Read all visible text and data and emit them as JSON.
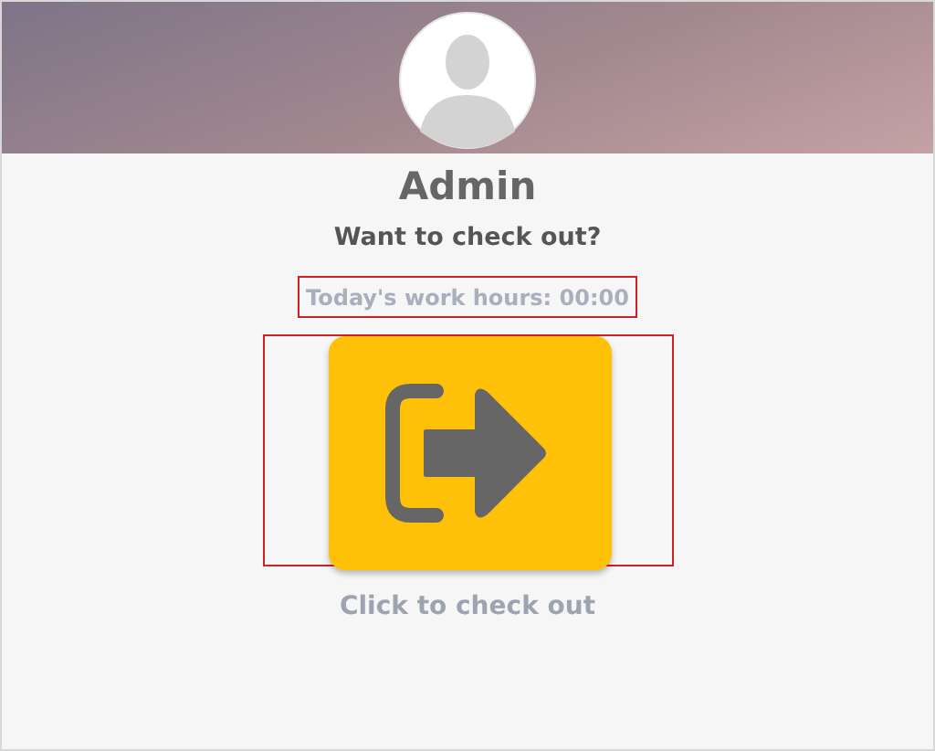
{
  "user": {
    "name": "Admin"
  },
  "prompt": "Want to check out?",
  "work_hours": "Today's work hours: 00:00",
  "check_out_caption": "Click to check out"
}
